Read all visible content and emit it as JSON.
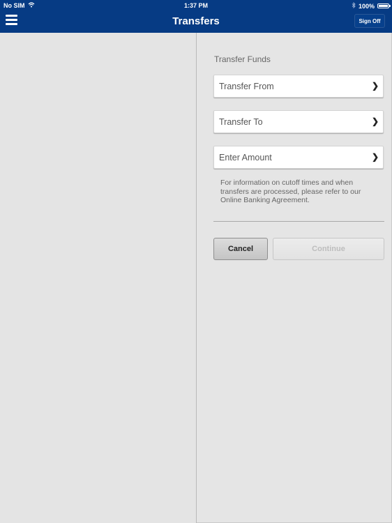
{
  "status_bar": {
    "carrier": "No SIM",
    "time": "1:37 PM",
    "battery_text": "100%",
    "battery_level": 1.0,
    "icons": [
      "wifi-icon",
      "bluetooth-icon",
      "battery-icon"
    ]
  },
  "nav_bar": {
    "title": "Transfers",
    "menu_icon": "hamburger-menu-icon",
    "sign_off_label": "Sign Off",
    "background_color": "#063b84"
  },
  "transfer_form": {
    "section_title": "Transfer Funds",
    "fields": [
      {
        "label": "Transfer From",
        "icon": "chevron-right-icon"
      },
      {
        "label": "Transfer To",
        "icon": "chevron-right-icon"
      },
      {
        "label": "Enter Amount",
        "icon": "chevron-right-icon"
      }
    ],
    "info_text": "For information on cutoff times and when transfers are processed, please refer to our Online Banking Agreement.",
    "buttons": {
      "cancel_label": "Cancel",
      "continue_label": "Continue",
      "continue_enabled": false
    }
  }
}
